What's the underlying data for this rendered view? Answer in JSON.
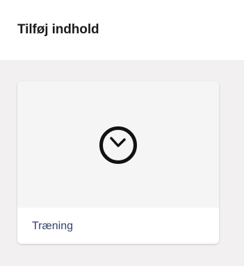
{
  "header": {
    "title": "Tilføj indhold"
  },
  "content": {
    "cards": [
      {
        "label": "Træning",
        "icon": "clock-icon"
      }
    ]
  },
  "colors": {
    "page_background": "#f2f0f0",
    "header_background": "#ffffff",
    "card_label": "#33416b",
    "icon": "#111111"
  }
}
